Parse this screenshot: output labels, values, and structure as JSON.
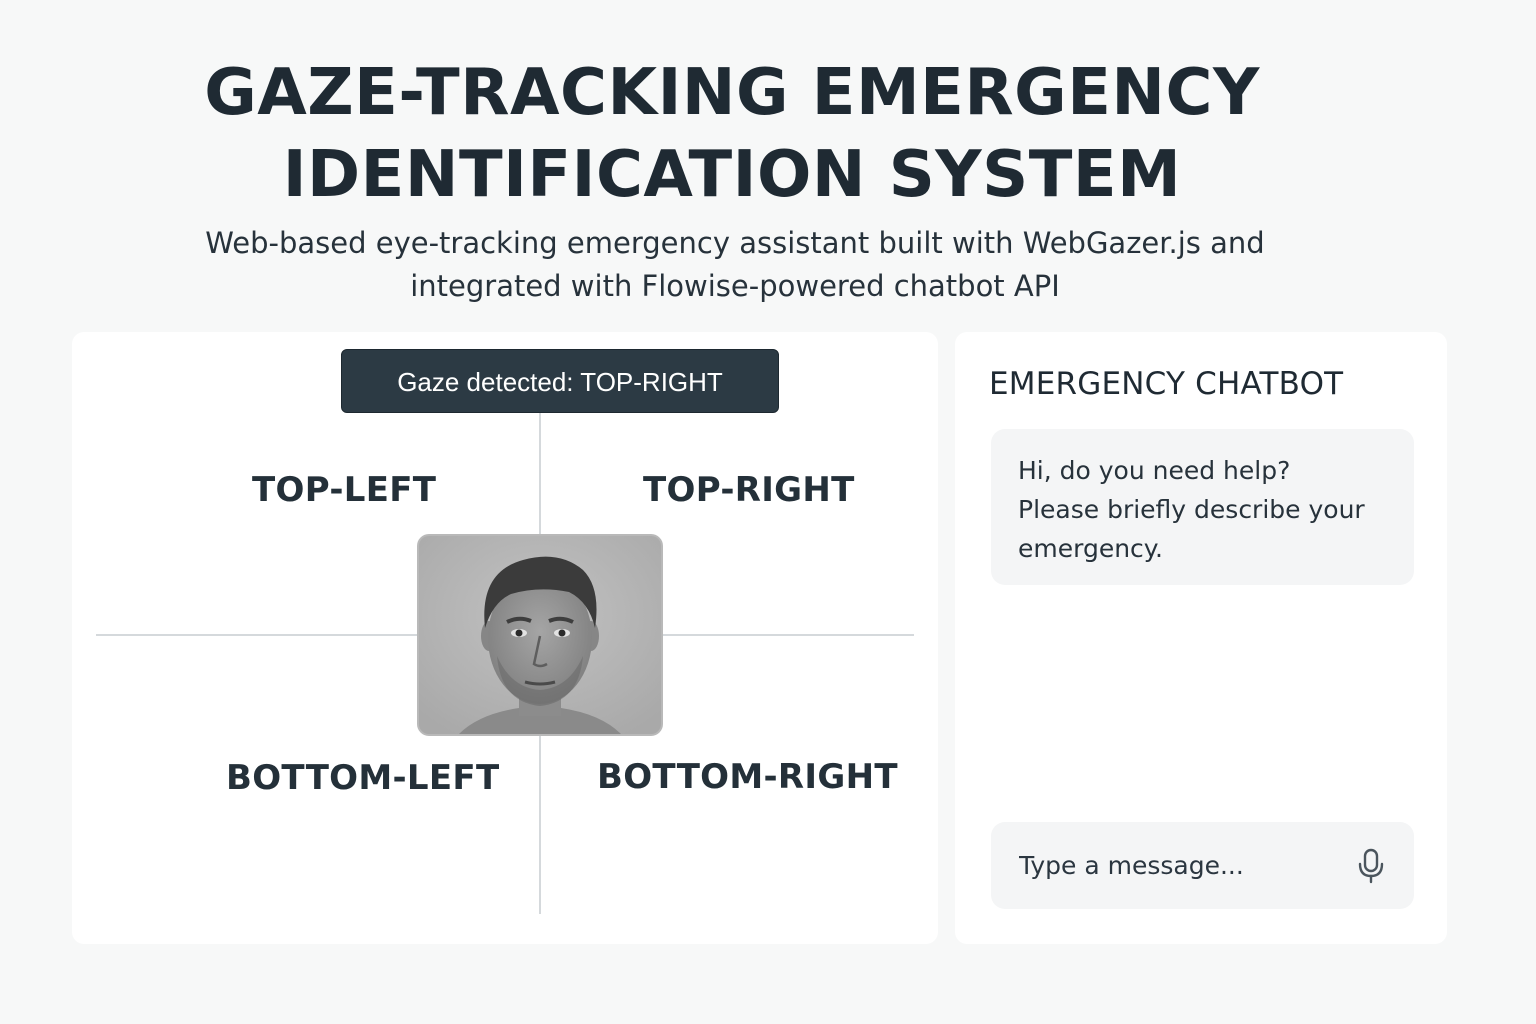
{
  "header": {
    "title_line1": "GAZE-TRACKING EMERGENCY",
    "title_line2": "IDENTIFICATION SYSTEM",
    "subtitle_line1": "Web-based eye-tracking emergency assistant built with WebGazer.js and",
    "subtitle_line2": "integrated with Flowise-powered chatbot API"
  },
  "gaze_panel": {
    "status_banner": "Gaze detected: TOP-RIGHT",
    "quadrants": {
      "top_left": "TOP-LEFT",
      "top_right": "TOP-RIGHT",
      "bottom_left": "BOTTOM-LEFT",
      "bottom_right": "BOTTOM-RIGHT"
    },
    "camera_feed_icon": "webcam-face-image"
  },
  "chat_panel": {
    "title": "EMERGENCY CHATBOT",
    "bot_message_line1": "Hi, do you need help?",
    "bot_message_line2": "Please briefly describe your",
    "bot_message_line3": "emergency.",
    "input_placeholder": "Type a message...",
    "mic_icon": "microphone-icon"
  },
  "colors": {
    "background": "#f7f8f8",
    "panel": "#ffffff",
    "banner": "#2c3a44",
    "text": "#1f2a33",
    "bubble": "#f4f5f6",
    "divider": "#d5d9dc"
  }
}
